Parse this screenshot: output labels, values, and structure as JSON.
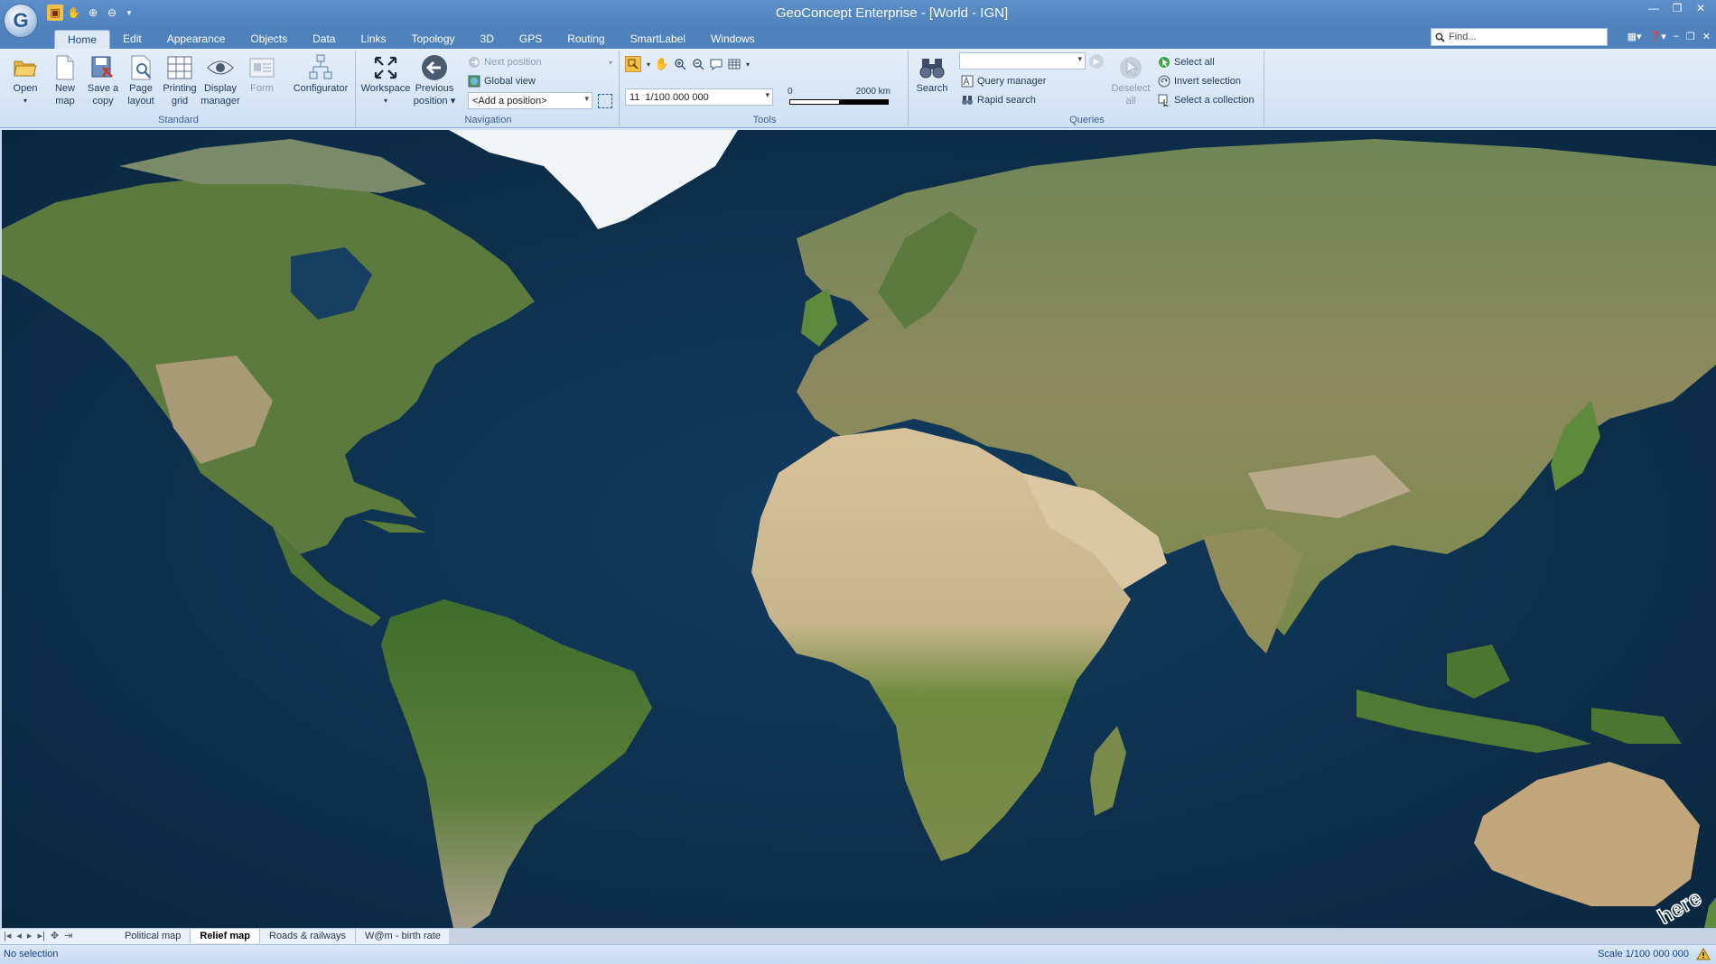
{
  "window": {
    "title": "GeoConcept Enterprise - [World - IGN]",
    "app_icon": "G",
    "qat_icons": [
      "select-tool-icon",
      "pan-hand-icon",
      "zoom-in-icon",
      "zoom-out-icon",
      "customize-arrow-icon"
    ],
    "controls": [
      "minimize-icon",
      "restore-icon",
      "close-icon"
    ]
  },
  "tabs": [
    "Home",
    "Edit",
    "Appearance",
    "Objects",
    "Data",
    "Links",
    "Topology",
    "3D",
    "GPS",
    "Routing",
    "SmartLabel",
    "Windows"
  ],
  "active_tab": "Home",
  "find": {
    "placeholder": "Find..."
  },
  "ribbon": {
    "standard": {
      "label": "Standard",
      "buttons": [
        {
          "label1": "Open",
          "label2": ""
        },
        {
          "label1": "New",
          "label2": "map"
        },
        {
          "label1": "Save a",
          "label2": "copy"
        },
        {
          "label1": "Page",
          "label2": "layout"
        },
        {
          "label1": "Printing",
          "label2": "grid"
        },
        {
          "label1": "Display",
          "label2": "manager"
        },
        {
          "label1": "Form",
          "label2": ""
        },
        {
          "label1": "Configurator",
          "label2": ""
        }
      ]
    },
    "navigation": {
      "label": "Navigation",
      "workspace": "Workspace",
      "previous_1": "Previous",
      "previous_2": "position",
      "next_position": "Next position",
      "global_view": "Global view",
      "position_combo": "<Add a position>"
    },
    "tools": {
      "label": "Tools",
      "scale_level": "11",
      "scale_value": "1/100 000 000",
      "scalebar_start": "0",
      "scalebar_end": "2000 km"
    },
    "queries": {
      "label": "Queries",
      "search": "Search",
      "query_manager": "Query manager",
      "rapid_search": "Rapid search",
      "deselect_1": "Deselect",
      "deselect_2": "all",
      "select_all": "Select all",
      "invert_selection": "Invert selection",
      "select_collection": "Select a collection"
    }
  },
  "map": {
    "watermark": "here"
  },
  "sheets": [
    "Political map",
    "Relief map",
    "Roads & railways",
    "W@m - birth rate"
  ],
  "active_sheet": "Relief map",
  "status": {
    "left": "No selection",
    "right": "Scale 1/100 000 000"
  },
  "colors": {
    "ocean": "#0b2e4a",
    "land": "#5f7d3a",
    "desert": "#c8b48a",
    "ice": "#f4f6f7",
    "ribbon": "#dfe9f5",
    "title": "#4f81bd"
  }
}
